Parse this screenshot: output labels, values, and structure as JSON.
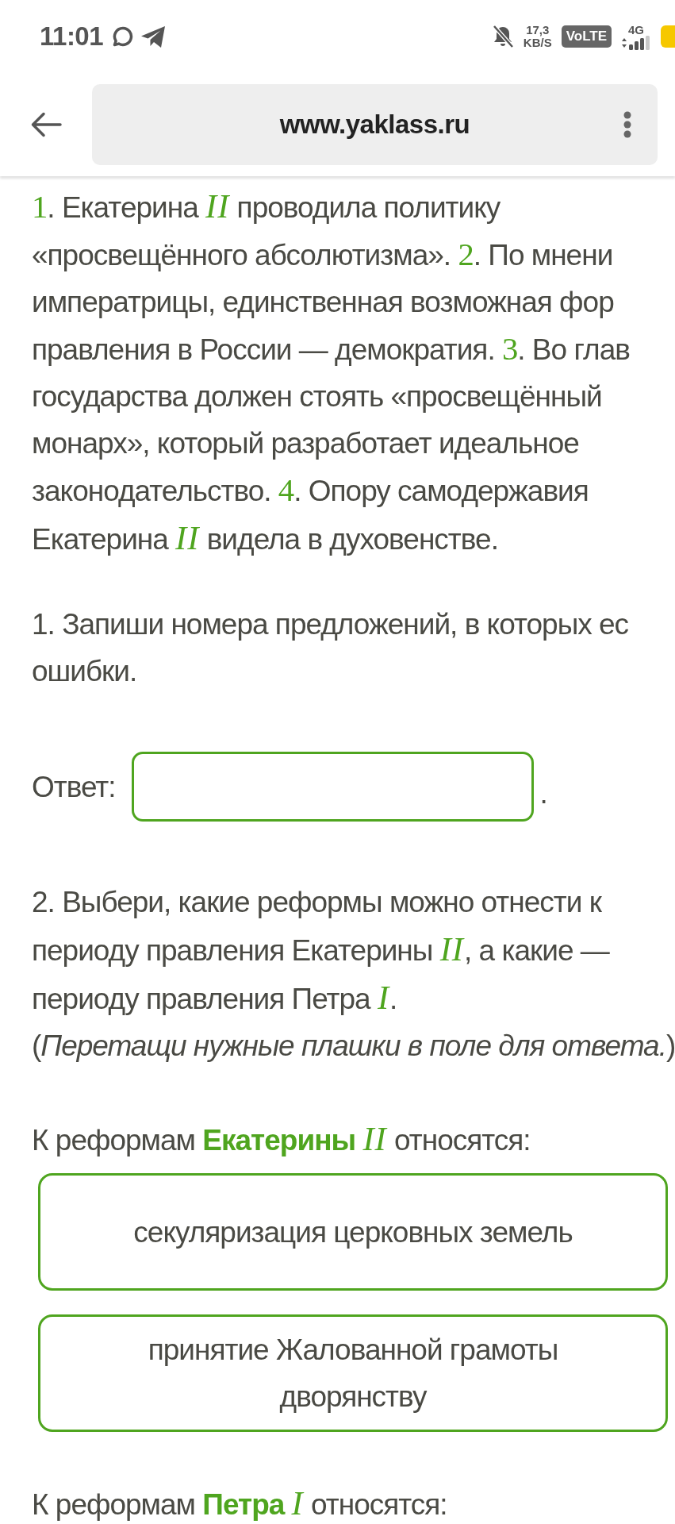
{
  "status_bar": {
    "time": "11:01",
    "speed_value": "17,3",
    "speed_unit": "KB/S",
    "volte": "VoLTE",
    "network": "4G"
  },
  "browser": {
    "url": "www.yaklass.ru"
  },
  "passage": {
    "lines": [
      "**1**. Екатерина *II* проводила политику",
      "«просвещённого абсолютизма». **2**. По мнени",
      "императрицы, единственная возможная фор",
      "правления в России — демократия. **3**. Во глав",
      "государства должен стоять «просвещённый",
      "монарх», который разработает идеальное",
      "законодательство. **4**. Опору самодержавия",
      "Екатерина *II* видела в духовенстве."
    ]
  },
  "task_1": {
    "prompt_lines": [
      "1. Запиши номера предложений, в которых ес",
      "ошибки."
    ],
    "answer": {
      "label": "Ответ:",
      "suffix": "."
    }
  },
  "task_2": {
    "prompt_lines": [
      "2. Выбери, какие реформы можно отнести к",
      "периоду правления Екатерины *II*, а какие —",
      "периоду правления Петра *I*."
    ],
    "hint": "(*Перетащи нужные плашки в поле для ответа.*)",
    "groups": [
      {
        "heading": "К реформам **Екатерины** *II* относятся:",
        "tiles": [
          "секуляризация церковных земель",
          "принятие Жалованной грамоты дворянству"
        ]
      },
      {
        "heading": "К реформам **Петра** *I* относятся:"
      }
    ]
  }
}
